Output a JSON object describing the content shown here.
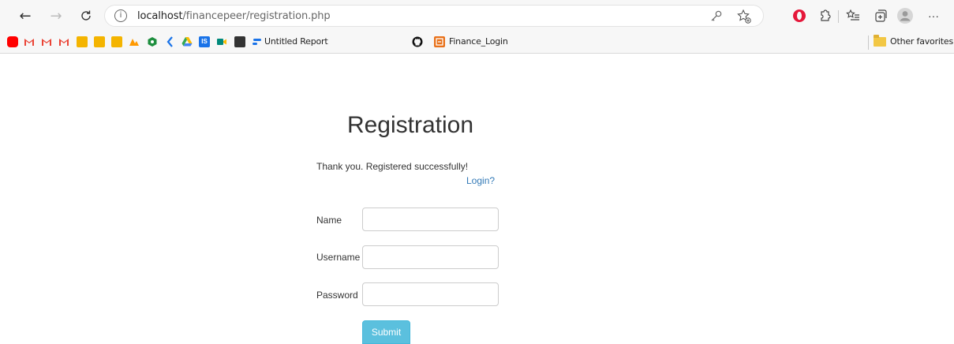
{
  "browser": {
    "url_host": "localhost",
    "url_path": "/financepeer/registration.php",
    "more_label": "···"
  },
  "bookmarks": {
    "untitled_report": "Untitled Report",
    "finance_login": "Finance_Login",
    "other_favorites": "Other favorites"
  },
  "page": {
    "title": "Registration",
    "message": "Thank you. Registered successfully!",
    "login_link": "Login?",
    "fields": {
      "name_label": "Name",
      "username_label": "Username",
      "password_label": "Password",
      "name_value": "",
      "username_value": "",
      "password_value": ""
    },
    "submit_label": "Submit"
  },
  "colors": {
    "link": "#337ab7",
    "submit": "#5bc0de"
  }
}
